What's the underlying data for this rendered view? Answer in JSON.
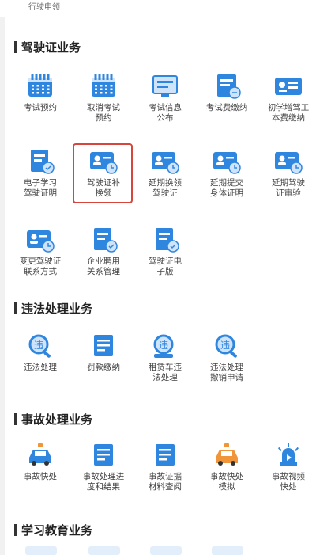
{
  "top_label": "行驶申领",
  "sections": [
    {
      "title": "驾驶证业务",
      "items": [
        {
          "label": "考试预约",
          "icon": "calendar-icon"
        },
        {
          "label": "取消考试\n预约",
          "icon": "calendar-cancel-icon"
        },
        {
          "label": "考试信息\n公布",
          "icon": "monitor-icon"
        },
        {
          "label": "考试费缴纳",
          "icon": "receipt-icon"
        },
        {
          "label": "初学增驾工\n本费缴纳",
          "icon": "id-card-icon"
        },
        {
          "label": "电子学习\n驾驶证明",
          "icon": "document-icon"
        },
        {
          "label": "驾驶证补\n换领",
          "icon": "license-renew-icon",
          "highlighted": true
        },
        {
          "label": "延期换领\n驾驶证",
          "icon": "license-clock-icon"
        },
        {
          "label": "延期提交\n身体证明",
          "icon": "license-plus-icon"
        },
        {
          "label": "延期驾驶\n证审验",
          "icon": "license-check-icon"
        },
        {
          "label": "变更驾驶证\n联系方式",
          "icon": "license-contact-icon"
        },
        {
          "label": "企业聘用\n关系管理",
          "icon": "enterprise-doc-icon"
        },
        {
          "label": "驾驶证电\n子版",
          "icon": "e-license-icon"
        }
      ]
    },
    {
      "title": "违法处理业务",
      "items": [
        {
          "label": "违法处理",
          "icon": "violation-search-icon"
        },
        {
          "label": "罚款缴纳",
          "icon": "fine-payment-icon"
        },
        {
          "label": "租赁车违\n法处理",
          "icon": "rental-car-icon"
        },
        {
          "label": "违法处理\n撤销申请",
          "icon": "revoke-search-icon"
        }
      ]
    },
    {
      "title": "事故处理业务",
      "items": [
        {
          "label": "事故快处",
          "icon": "car-accident-icon"
        },
        {
          "label": "事故处理进\n度和结果",
          "icon": "progress-doc-icon"
        },
        {
          "label": "事故证据\n材料查阅",
          "icon": "evidence-doc-icon"
        },
        {
          "label": "事故快处\n模拟",
          "icon": "simulate-car-icon"
        },
        {
          "label": "事故视频\n快处",
          "icon": "video-siren-icon"
        }
      ]
    },
    {
      "title": "学习教育业务",
      "items": []
    }
  ],
  "colors": {
    "primary": "#2f86de",
    "light": "#cfe4fb",
    "accent_orange": "#f0953a",
    "highlight_border": "#d6463d"
  }
}
